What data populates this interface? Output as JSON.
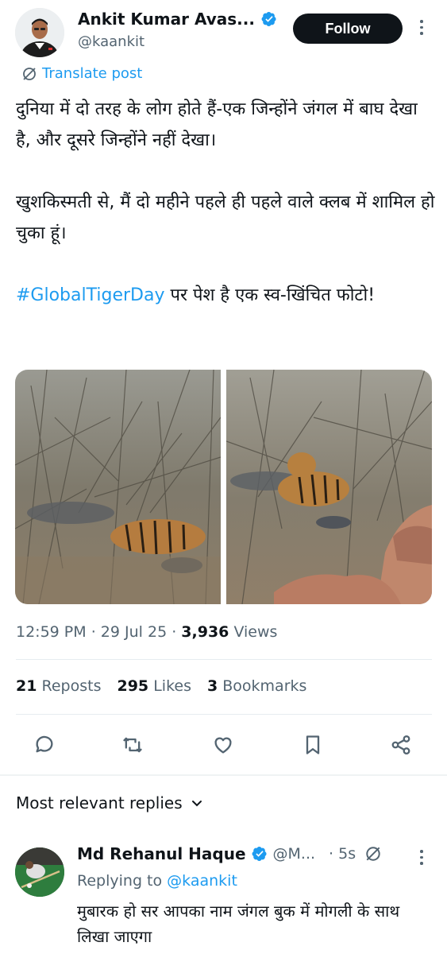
{
  "author": {
    "name": "Ankit Kumar Avas...",
    "handle": "@kaankit",
    "verified": true,
    "follow_label": "Follow"
  },
  "translate_label": "Translate post",
  "post": {
    "line1": "दुनिया में दो तरह के लोग होते हैं-एक जिन्होंने जंगल में बाघ देखा है, और दूसरे जिन्होंने नहीं देखा।",
    "line2": "खुशकिस्मती से, मैं दो महीने पहले ही पहले वाले क्लब में शामिल हो चुका हूं।",
    "hashtag": "#GlobalTigerDay",
    "line3_rest": " पर पेश है एक स्व-खिंचित फोटो!"
  },
  "meta": {
    "time": "12:59 PM",
    "date": "29 Jul 25",
    "views_count": "3,936",
    "views_label": "Views"
  },
  "stats": {
    "reposts_count": "21",
    "reposts_label": "Reposts",
    "likes_count": "295",
    "likes_label": "Likes",
    "bookmarks_count": "3",
    "bookmarks_label": "Bookmarks"
  },
  "actions": [
    "reply-icon",
    "repost-icon",
    "like-icon",
    "bookmark-icon",
    "share-icon"
  ],
  "replies_header": "Most relevant replies",
  "reply": {
    "name": "Md Rehanul Haque",
    "handle": "@M...",
    "time": "· 5s",
    "replying_prefix": "Replying to",
    "replying_to": "@kaankit",
    "text": "मुबारक हो सर आपका नाम जंगल बुक में मोगली के साथ लिखा जाएगा"
  },
  "colors": {
    "accent": "#1d9bf0",
    "verified": "#1d9bf0",
    "text": "#0f1419",
    "muted": "#536471"
  }
}
